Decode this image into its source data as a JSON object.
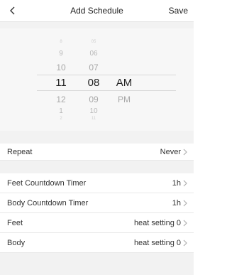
{
  "header": {
    "title": "Add Schedule",
    "save_label": "Save",
    "back_icon": "chevron-left-icon"
  },
  "picker": {
    "hours": [
      "8",
      "9",
      "10",
      "11",
      "12",
      "1",
      "2"
    ],
    "minutes": [
      "05",
      "06",
      "07",
      "08",
      "09",
      "10",
      "11"
    ],
    "periods": [
      "AM",
      "PM"
    ],
    "selected": {
      "hour": "11",
      "minute": "08",
      "period": "AM"
    }
  },
  "settings": {
    "repeat": {
      "label": "Repeat",
      "value": "Never"
    },
    "feet_timer": {
      "label": "Feet Countdown Timer",
      "value": "1h"
    },
    "body_timer": {
      "label": "Body Countdown Timer",
      "value": "1h"
    },
    "feet": {
      "label": "Feet",
      "value": "heat setting 0"
    },
    "body": {
      "label": "Body",
      "value": "heat setting 0"
    }
  }
}
